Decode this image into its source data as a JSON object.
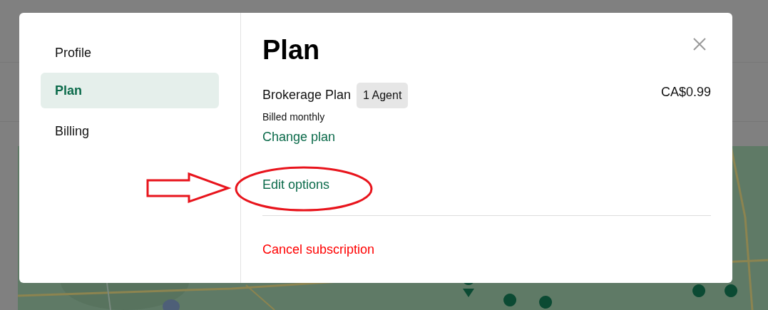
{
  "sidebar": {
    "items": [
      {
        "label": "Profile",
        "selected": false
      },
      {
        "label": "Plan",
        "selected": true
      },
      {
        "label": "Billing",
        "selected": false
      }
    ]
  },
  "title": "Plan",
  "plan": {
    "name": "Brokerage Plan",
    "badge": "1 Agent",
    "price": "CA$0.99",
    "billing": "Billed monthly"
  },
  "links": [
    {
      "label": "Change plan",
      "kind": "primary"
    },
    {
      "label": "Edit options",
      "kind": "primary"
    },
    {
      "label": "Cancel subscription",
      "kind": "danger"
    }
  ],
  "annotations": {
    "arrow": true,
    "ellipse": true
  }
}
